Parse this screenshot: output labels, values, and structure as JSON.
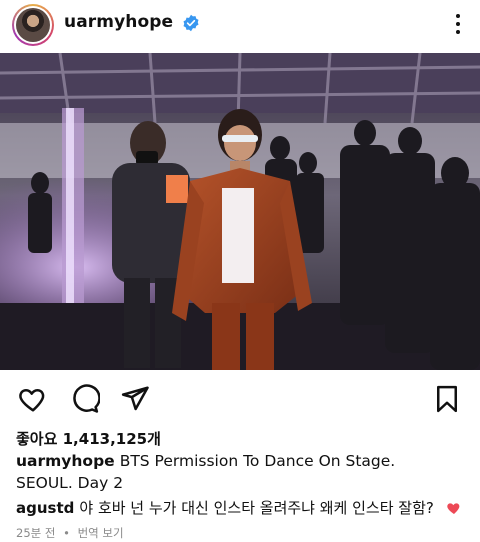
{
  "post": {
    "username": "uarmyhope",
    "verified": true
  },
  "actions": {
    "like_icon": "heart-outline-icon",
    "comment_icon": "comment-bubble-icon",
    "share_icon": "paper-plane-icon",
    "save_icon": "bookmark-icon"
  },
  "likes": {
    "text": "좋아요 1,413,125개"
  },
  "caption": {
    "username": "uarmyhope",
    "text": "BTS Permission To Dance On Stage. SEOUL. Day 2"
  },
  "comment": {
    "username": "agustd",
    "text": "야 호바 넌 누가 대신 인스타 올려주냐 왜케 인스타 잘함?",
    "liked": true
  },
  "meta": {
    "time": "25분 전",
    "separator": "•",
    "translate": "번역 보기"
  },
  "colors": {
    "verified_blue": "#3897f0",
    "liked_red": "#ed4956",
    "muted_text": "#8a8a8a"
  }
}
